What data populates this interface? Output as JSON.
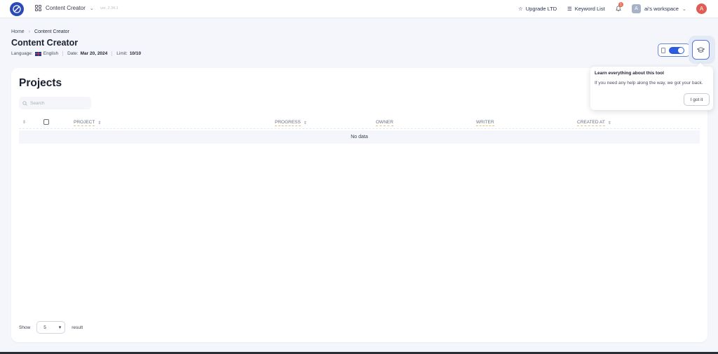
{
  "topbar": {
    "app_name": "Content Creator",
    "version": "ver. 2.34.1",
    "upgrade_label": "Upgrade LTD",
    "keyword_label": "Keyword List",
    "notification_count": "1",
    "workspace_initial": "A",
    "workspace_label": "ai's workspace",
    "user_initial": "A"
  },
  "header": {
    "breadcrumb_home": "Home",
    "breadcrumb_current": "Content Creator",
    "title": "Content Creator",
    "language_label": "Language:",
    "language_value": "English",
    "date_label": "Date:",
    "date_value": "Mar 20, 2024",
    "limit_label": "Limit:",
    "limit_value": "10/10"
  },
  "card": {
    "title": "Projects",
    "search_placeholder": "Search",
    "columns": [
      "PROJECT",
      "PROGRESS",
      "OWNER",
      "WRITER",
      "CREATED AT"
    ],
    "empty_text": "No data",
    "show_label": "Show",
    "page_size": "5",
    "result_label": "result"
  },
  "tooltip": {
    "title": "Learn everything about this tool",
    "body": "If you need any help along the way, we got your back.",
    "button": "I got it"
  },
  "colors": {
    "accent": "#2c5be0",
    "badge": "#ec6b55",
    "avatar": "#e05c55"
  }
}
